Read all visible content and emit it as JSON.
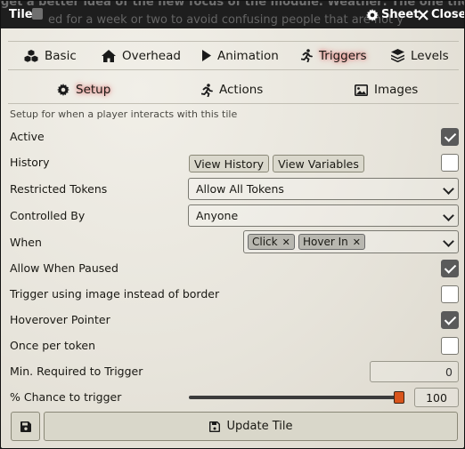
{
  "window": {
    "title": "Tile",
    "background_text_line1": "get a better idea of the new focus of the module. Weather: The one the more",
    "background_text_line2": "ed for a week or two to avoid confusing people that are not y",
    "sheet_label": "Sheet",
    "close_label": "Close"
  },
  "tabs": [
    {
      "label": "Basic",
      "icon": "cubes-icon",
      "active": false
    },
    {
      "label": "Overhead",
      "icon": "home-icon",
      "active": false
    },
    {
      "label": "Animation",
      "icon": "play-icon",
      "active": false
    },
    {
      "label": "Triggers",
      "icon": "running-icon",
      "active": true
    },
    {
      "label": "Levels",
      "icon": "layers-icon",
      "active": false
    }
  ],
  "subtabs": [
    {
      "label": "Setup",
      "icon": "gear-icon",
      "active": true
    },
    {
      "label": "Actions",
      "icon": "running-icon",
      "active": false
    },
    {
      "label": "Images",
      "icon": "image-icon",
      "active": false
    }
  ],
  "hint": "Setup for when a player interacts with this tile",
  "fields": {
    "active": {
      "label": "Active",
      "checked": true
    },
    "history": {
      "label": "History",
      "view_history": "View History",
      "view_variables": "View Variables",
      "checked": false
    },
    "restricted_tokens": {
      "label": "Restricted Tokens",
      "value": "Allow All Tokens"
    },
    "controlled_by": {
      "label": "Controlled By",
      "value": "Anyone"
    },
    "when": {
      "label": "When",
      "chips": [
        "Click",
        "Hover In"
      ]
    },
    "allow_when_paused": {
      "label": "Allow When Paused",
      "checked": true
    },
    "trigger_using_image": {
      "label": "Trigger using image instead of border",
      "checked": false
    },
    "hoverover_pointer": {
      "label": "Hoverover Pointer",
      "checked": true
    },
    "once_per_token": {
      "label": "Once per token",
      "checked": false
    },
    "min_required": {
      "label": "Min. Required to Trigger",
      "value": "0"
    },
    "chance": {
      "label": "% Chance to trigger",
      "value": "100",
      "percent": 100
    }
  },
  "footer": {
    "update_label": "Update Tile"
  },
  "colors": {
    "accent_glow": "#e06666",
    "slider_handle": "#d9541b"
  }
}
